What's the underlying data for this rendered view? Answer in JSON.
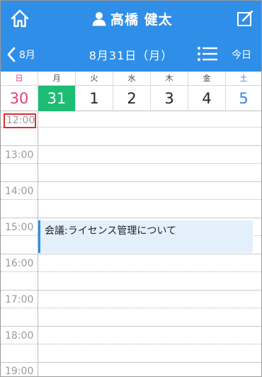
{
  "header": {
    "user_name": "高橋 健太",
    "nav_prev_label": "8月",
    "date_title": "8月31日（月）",
    "today_label": "今日"
  },
  "week": {
    "days": [
      {
        "weekday": "日",
        "date": "30",
        "kind": "sun"
      },
      {
        "weekday": "月",
        "date": "31",
        "kind": "selected"
      },
      {
        "weekday": "火",
        "date": "1",
        "kind": "normal"
      },
      {
        "weekday": "水",
        "date": "2",
        "kind": "normal"
      },
      {
        "weekday": "木",
        "date": "3",
        "kind": "normal"
      },
      {
        "weekday": "金",
        "date": "4",
        "kind": "normal"
      },
      {
        "weekday": "土",
        "date": "5",
        "kind": "sat"
      }
    ]
  },
  "times": {
    "current": "12:00",
    "slots": [
      "13:00",
      "14:00",
      "15:00",
      "16:00",
      "17:00",
      "18:00",
      "19:00"
    ]
  },
  "event": {
    "title": "会議:ライセンス管理について"
  },
  "colors": {
    "header_bg": "#2f8ee8",
    "selected_day": "#1dbc75",
    "sunday": "#e0406c",
    "saturday": "#3289e0",
    "current_time_box": "#d93030",
    "event_bg": "#e3f0fc"
  },
  "icons": {
    "home": "home-icon",
    "user": "user-icon",
    "edit": "edit-icon",
    "prev": "chevron-left-icon",
    "list": "list-view-icon"
  }
}
